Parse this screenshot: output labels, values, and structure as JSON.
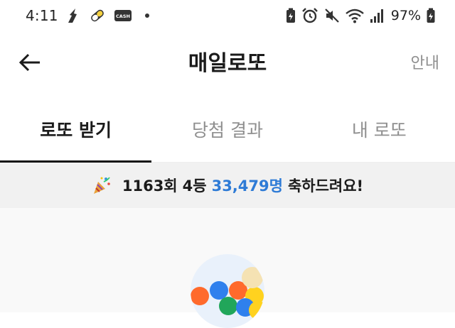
{
  "status_bar": {
    "time": "4:11",
    "battery_percent": "97%",
    "left_icons": [
      "accessibility-icon",
      "pill-icon",
      "cash-app-icon",
      "notification-dot-icon"
    ],
    "right_icons": [
      "battery-saver-icon",
      "alarm-icon",
      "mute-icon",
      "wifi-icon",
      "signal-icon",
      "battery-icon"
    ],
    "cash_label": "CASH"
  },
  "header": {
    "title": "매일로또",
    "back_icon": "arrow-left-icon",
    "guide_label": "안내"
  },
  "tabs": [
    {
      "label": "로또 받기",
      "active": true
    },
    {
      "label": "당첨 결과",
      "active": false
    },
    {
      "label": "내 로또",
      "active": false
    }
  ],
  "banner": {
    "icon": "party-popper-icon",
    "round": "1163회",
    "rank": "4등",
    "winners": "33,479명",
    "message": "축하드려요!"
  },
  "illustration": {
    "icon": "lotto-balls-icon",
    "ball_colors": [
      "#ff6a2c",
      "#2f80ed",
      "#ff6a2c",
      "#ffd21f",
      "#21a65a",
      "#2f80ed",
      "#ffd21f",
      "#f5e2b3"
    ]
  },
  "colors": {
    "accent": "#2e7bd6",
    "banner_bg": "#f1f1f1",
    "tab_active": "#1b1b1b",
    "tab_inactive": "#8f8f8f"
  }
}
